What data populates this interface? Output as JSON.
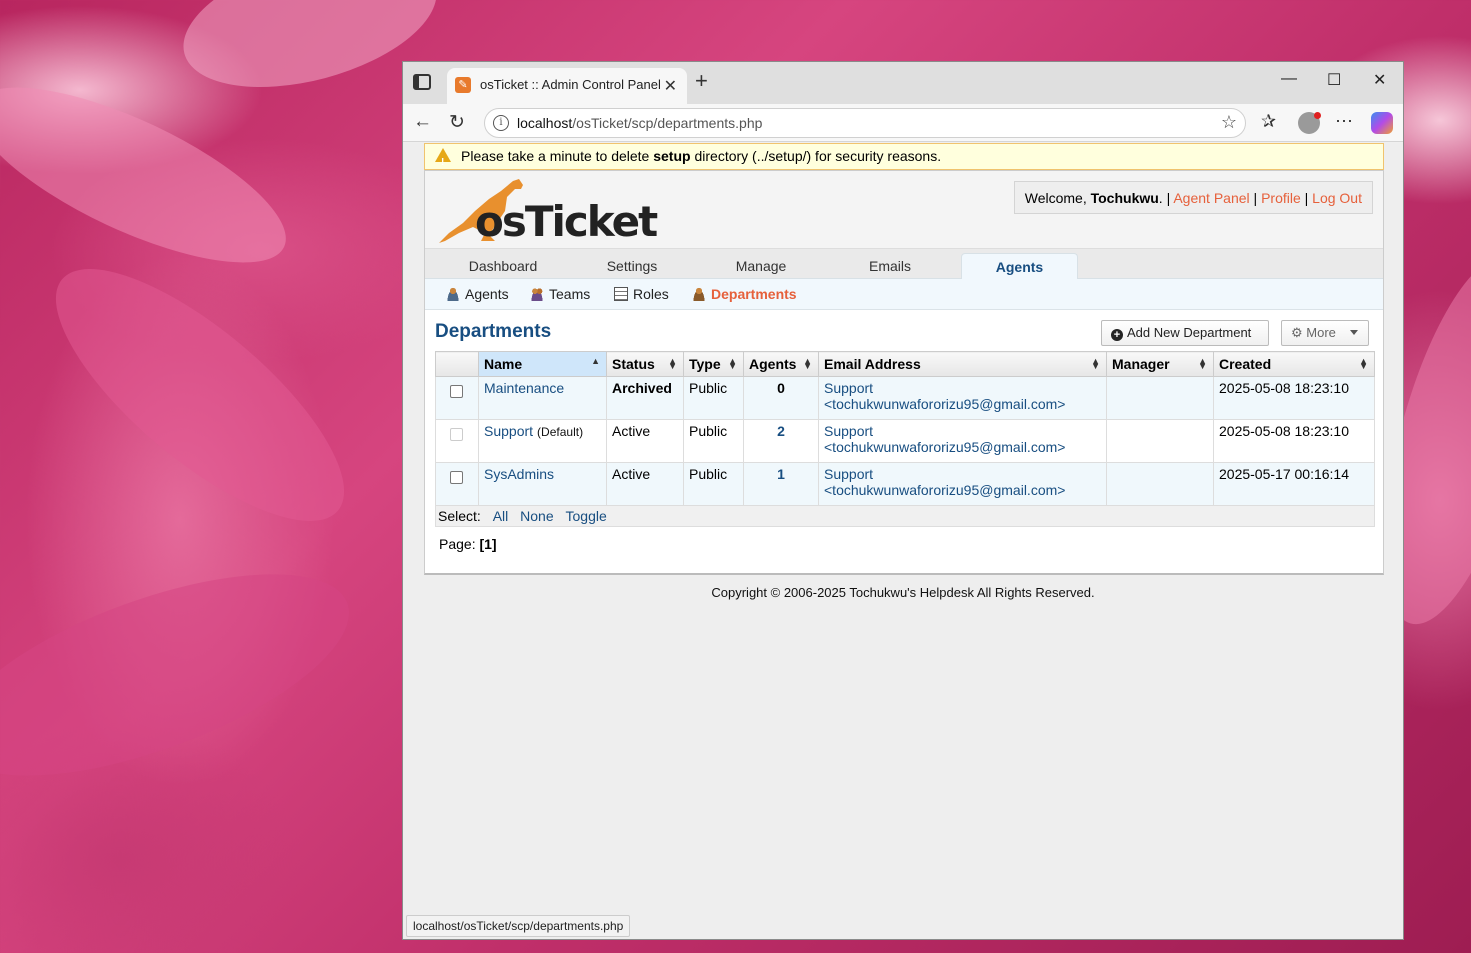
{
  "browser": {
    "tab_title": "osTicket :: Admin Control Panel",
    "url_host": "localhost",
    "url_path": "/osTicket/scp/departments.php",
    "status_url": "localhost/osTicket/scp/departments.php"
  },
  "warning": {
    "prefix": "Please take a minute to delete ",
    "bold": "setup",
    "suffix": " directory (../setup/) for security reasons."
  },
  "header": {
    "logo_text": "osTicket",
    "welcome_prefix": "Welcome, ",
    "username": "Tochukwu",
    "welcome_suffix": ". | ",
    "links": [
      "Agent Panel",
      "Profile",
      "Log Out"
    ]
  },
  "nav": {
    "tabs": [
      "Dashboard",
      "Settings",
      "Manage",
      "Emails",
      "Agents"
    ],
    "active": "Agents"
  },
  "subnav": {
    "items": [
      "Agents",
      "Teams",
      "Roles",
      "Departments"
    ],
    "active": "Departments"
  },
  "main": {
    "title": "Departments",
    "add_button": "Add New Department",
    "more_button": "More"
  },
  "table": {
    "columns": [
      "Name",
      "Status",
      "Type",
      "Agents",
      "Email Address",
      "Manager",
      "Created"
    ],
    "rows": [
      {
        "name": "Maintenance",
        "tag": "",
        "status": "Archived",
        "type": "Public",
        "agents": "0",
        "email_name": "Support",
        "email_addr": "<tochukwunwafororizu95@gmail.com>",
        "manager": "",
        "created": "2025-05-08 18:23:10"
      },
      {
        "name": "Support",
        "tag": "(Default)",
        "status": "Active",
        "type": "Public",
        "agents": "2",
        "email_name": "Support",
        "email_addr": "<tochukwunwafororizu95@gmail.com>",
        "manager": "",
        "created": "2025-05-08 18:23:10"
      },
      {
        "name": "SysAdmins",
        "tag": "",
        "status": "Active",
        "type": "Public",
        "agents": "1",
        "email_name": "Support",
        "email_addr": "<tochukwunwafororizu95@gmail.com>",
        "manager": "",
        "created": "2025-05-17 00:16:14"
      }
    ],
    "select_label": "Select:",
    "select_links": [
      "All",
      "None",
      "Toggle"
    ]
  },
  "pager": {
    "label": "Page:",
    "current": "[1]"
  },
  "footer": {
    "copyright": "Copyright © 2006-2025 Tochukwu's Helpdesk All Rights Reserved."
  }
}
